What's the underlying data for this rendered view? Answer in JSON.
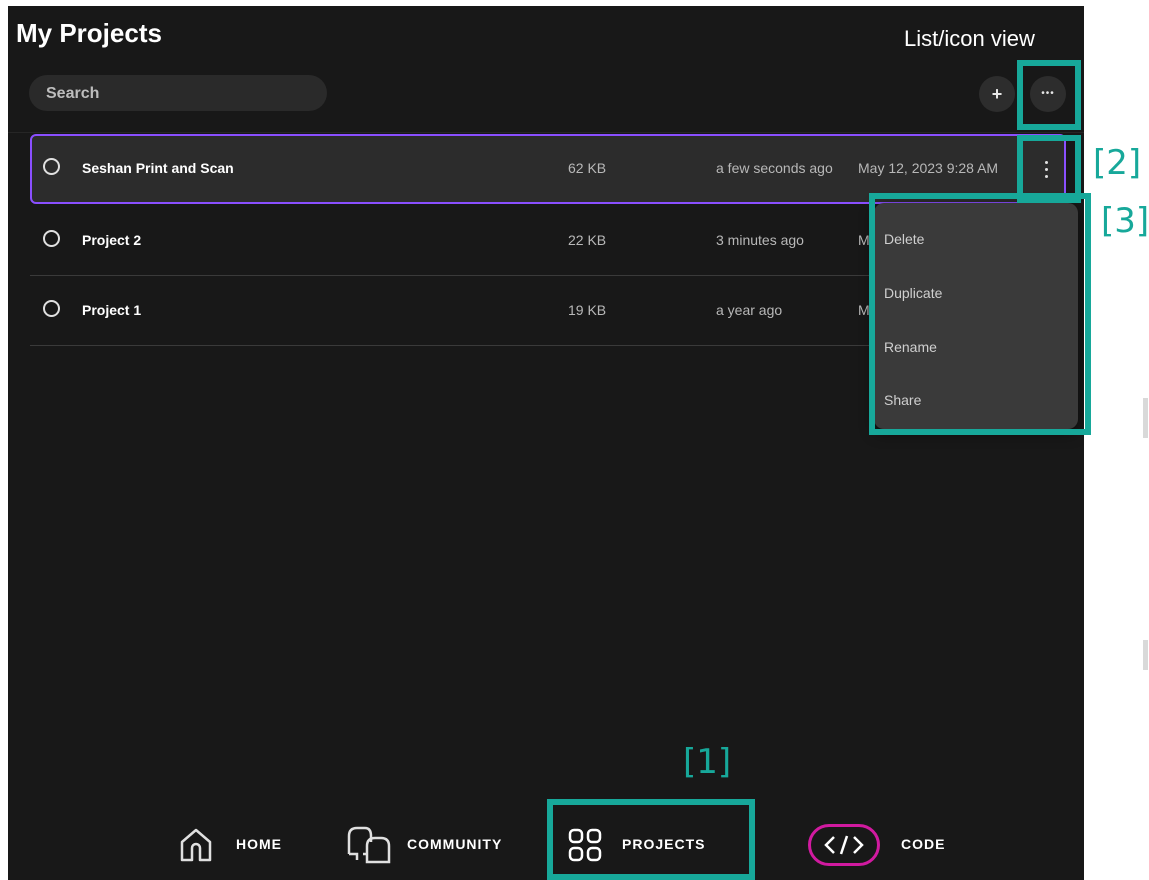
{
  "header": {
    "title": "My Projects",
    "search_placeholder": "Search",
    "add_label": "+",
    "more_label": "•••"
  },
  "annotations": {
    "list_icon_view": "List/icon view",
    "marker_1": "[1]",
    "marker_2": "[2]",
    "marker_3": "[3]",
    "accent_color": "#17a89a"
  },
  "projects": [
    {
      "name": "Seshan Print and Scan",
      "size": "62 KB",
      "modified": "a few seconds ago",
      "created": "May 12, 2023 9:28 AM",
      "selected": true
    },
    {
      "name": "Project 2",
      "size": "22 KB",
      "modified": "3 minutes ago",
      "created": "M",
      "selected": false
    },
    {
      "name": "Project 1",
      "size": "19 KB",
      "modified": "a year ago",
      "created": "M",
      "selected": false
    }
  ],
  "context_menu": {
    "items": [
      "Delete",
      "Duplicate",
      "Rename",
      "Share"
    ]
  },
  "bottom_nav": {
    "items": [
      {
        "label": "HOME",
        "icon": "home-icon"
      },
      {
        "label": "COMMUNITY",
        "icon": "community-icon"
      },
      {
        "label": "PROJECTS",
        "icon": "projects-grid-icon",
        "active": true
      },
      {
        "label": "CODE",
        "icon": "code-icon"
      }
    ]
  },
  "colors": {
    "background": "#181818",
    "selection_border": "#8a4fff",
    "code_highlight": "#d11aa0"
  }
}
